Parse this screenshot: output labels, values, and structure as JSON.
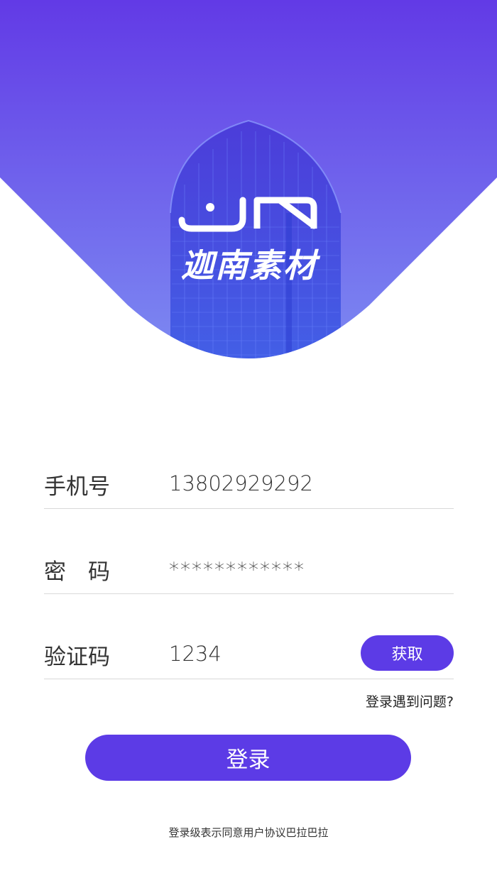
{
  "brand": {
    "logo_name": "JN",
    "name": "迦南素材"
  },
  "form": {
    "phone": {
      "label": "手机号",
      "value": "13802929292"
    },
    "password": {
      "label": "密　码",
      "value": "************"
    },
    "code": {
      "label": "验证码",
      "value": "1234",
      "button_label": "获取"
    }
  },
  "help_link": "登录遇到问题?",
  "login_button": "登录",
  "agreement_text": "登录级表示同意用户协议巴拉巴拉",
  "colors": {
    "primary": "#5c3be6",
    "hero_top": "#6a3de8",
    "hero_bottom": "#7b86f0"
  }
}
